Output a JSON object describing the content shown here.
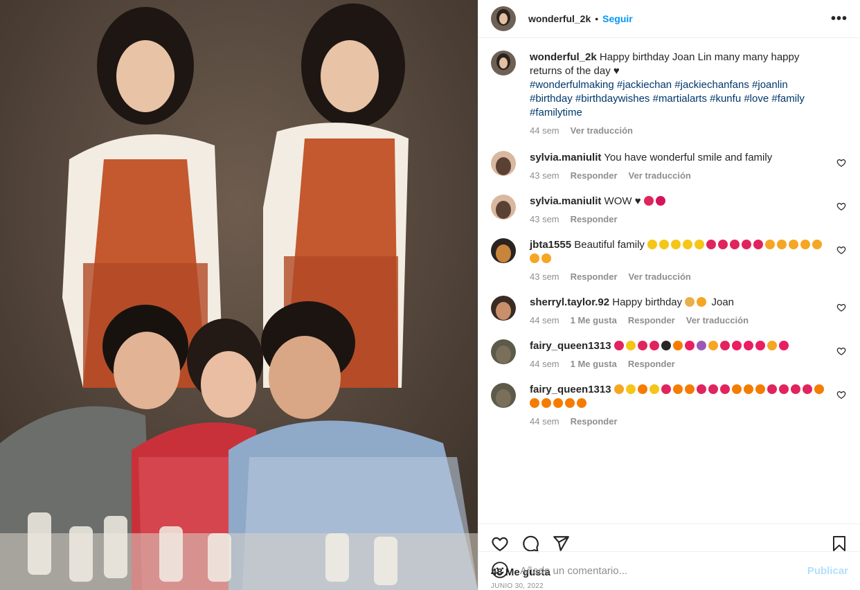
{
  "header": {
    "username": "wonderful_2k",
    "dot": "•",
    "follow_label": "Seguir",
    "more_label": "•••"
  },
  "caption": {
    "username": "wonderful_2k",
    "text": "Happy birthday Joan Lin many many happy returns of the day ♥",
    "hashtags": "#wonderfulmaking #jackiechan #jackiechanfans #joanlin #birthday #birthdaywishes #martialarts #kunfu #love #family #familytime",
    "time": "44 sem",
    "translate": "Ver traducción"
  },
  "comments": [
    {
      "username": "sylvia.maniulit",
      "text": "You have wonderful smile and family",
      "time": "43 sem",
      "likes": "",
      "reply": "Responder",
      "translate": "Ver traducción",
      "emojis": []
    },
    {
      "username": "sylvia.maniulit",
      "text": "WOW ♥",
      "time": "43 sem",
      "likes": "",
      "reply": "Responder",
      "translate": "",
      "emojis": [
        "#e0245e",
        "#d4145a"
      ]
    },
    {
      "username": "jbta1555",
      "text": "Beautiful family",
      "time": "43 sem",
      "likes": "",
      "reply": "Responder",
      "translate": "Ver traducción",
      "emojis": [
        "#f5c518",
        "#f5c518",
        "#f5c518",
        "#f5c518",
        "#f5c518",
        "#e0245e",
        "#e0245e",
        "#e0245e",
        "#e0245e",
        "#e0245e",
        "#f5a623",
        "#f5a623",
        "#f5a623",
        "#f5a623",
        "#f5a623",
        "#f5a623",
        "#f5a623"
      ]
    },
    {
      "username": "sherryl.taylor.92",
      "text": "Happy birthday",
      "text2": "Joan",
      "time": "44 sem",
      "likes": "1 Me gusta",
      "reply": "Responder",
      "translate": "Ver traducción",
      "emojis": [
        "#e8b04a",
        "#f5a623"
      ]
    },
    {
      "username": "fairy_queen1313",
      "text": "",
      "time": "44 sem",
      "likes": "1 Me gusta",
      "reply": "Responder",
      "translate": "",
      "emojis": [
        "#e0245e",
        "#f5c518",
        "#e0245e",
        "#e0245e",
        "#262626",
        "#f57c00",
        "#e91e63",
        "#9b59b6",
        "#f5a623",
        "#e0245e",
        "#e91e63",
        "#e91e63",
        "#e91e63",
        "#f5a623",
        "#e91e63"
      ]
    },
    {
      "username": "fairy_queen1313",
      "text": "",
      "time": "44 sem",
      "likes": "",
      "reply": "Responder",
      "translate": "",
      "emojis": [
        "#f5a623",
        "#f5c518",
        "#f57c00",
        "#f5c518",
        "#e0245e",
        "#f57c00",
        "#f57c00",
        "#e0245e",
        "#e0245e",
        "#e0245e",
        "#f57c00",
        "#f57c00",
        "#f57c00",
        "#e0245e",
        "#e0245e",
        "#e0245e",
        "#e0245e",
        "#f57c00",
        "#f57c00",
        "#f57c00",
        "#f57c00",
        "#f57c00",
        "#f57c00"
      ]
    }
  ],
  "footer": {
    "likes": "48 Me gusta",
    "date": "JUNIO 30, 2022",
    "comment_placeholder": "Añade un comentario...",
    "post_label": "Publicar"
  },
  "colors": {
    "accent": "#0095f6",
    "hashtag": "#00376b",
    "muted": "#8e8e8e"
  }
}
